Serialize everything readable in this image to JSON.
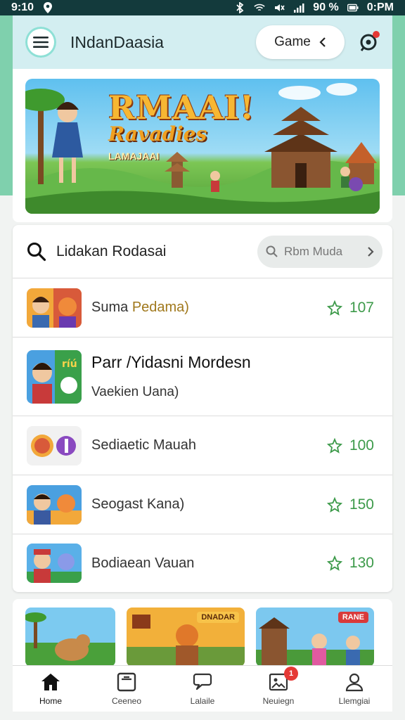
{
  "status_bar": {
    "time": "9:10",
    "battery_text": "90 %",
    "right_time": "0:PM",
    "icons": [
      "location-icon",
      "bluetooth-icon",
      "wifi-icon",
      "mute-icon",
      "signal-icon",
      "battery-icon"
    ]
  },
  "app_bar": {
    "title": "INdanDaasia",
    "game_button": "Game",
    "icons": [
      "menu-icon",
      "back-chevron-icon",
      "notification-icon"
    ]
  },
  "banner": {
    "title": "RMAAI!",
    "subtitle": "Ravadies",
    "small_text": "LAMAJAAI"
  },
  "search": {
    "text": "Lidakan Rodasai",
    "pill_label": "Rbm Muda"
  },
  "games": [
    {
      "name": "Suma ",
      "name_accent": "Pedama)",
      "score": "107",
      "icon": "star-icon"
    },
    {
      "title": "Parr /Yidasni Mordesn",
      "subtitle": "Vaekien Uana)"
    },
    {
      "name": "Sediaetic Mauah",
      "score": "100",
      "icon": "star-icon"
    },
    {
      "name": "Seogast Kana)",
      "score": "150",
      "icon": "star-icon"
    },
    {
      "name": "Bodiaean Vauan",
      "score": "130",
      "icon": "star-icon"
    }
  ],
  "strip": {
    "tile2_label": "DNADAR",
    "tile3_badge": "RANE"
  },
  "bottom_nav": [
    {
      "label": "Home",
      "icon": "home-icon"
    },
    {
      "label": "Ceeneo",
      "icon": "tablet-icon"
    },
    {
      "label": "Lalaile",
      "icon": "chat-icon"
    },
    {
      "label": "Neuiegn",
      "icon": "gallery-icon",
      "badge": "1"
    },
    {
      "label": "Llemgiai",
      "icon": "profile-icon"
    }
  ],
  "colors": {
    "accent_green": "#3d9a4a",
    "app_bar": "#d3eef1",
    "badge_red": "#e53935"
  }
}
